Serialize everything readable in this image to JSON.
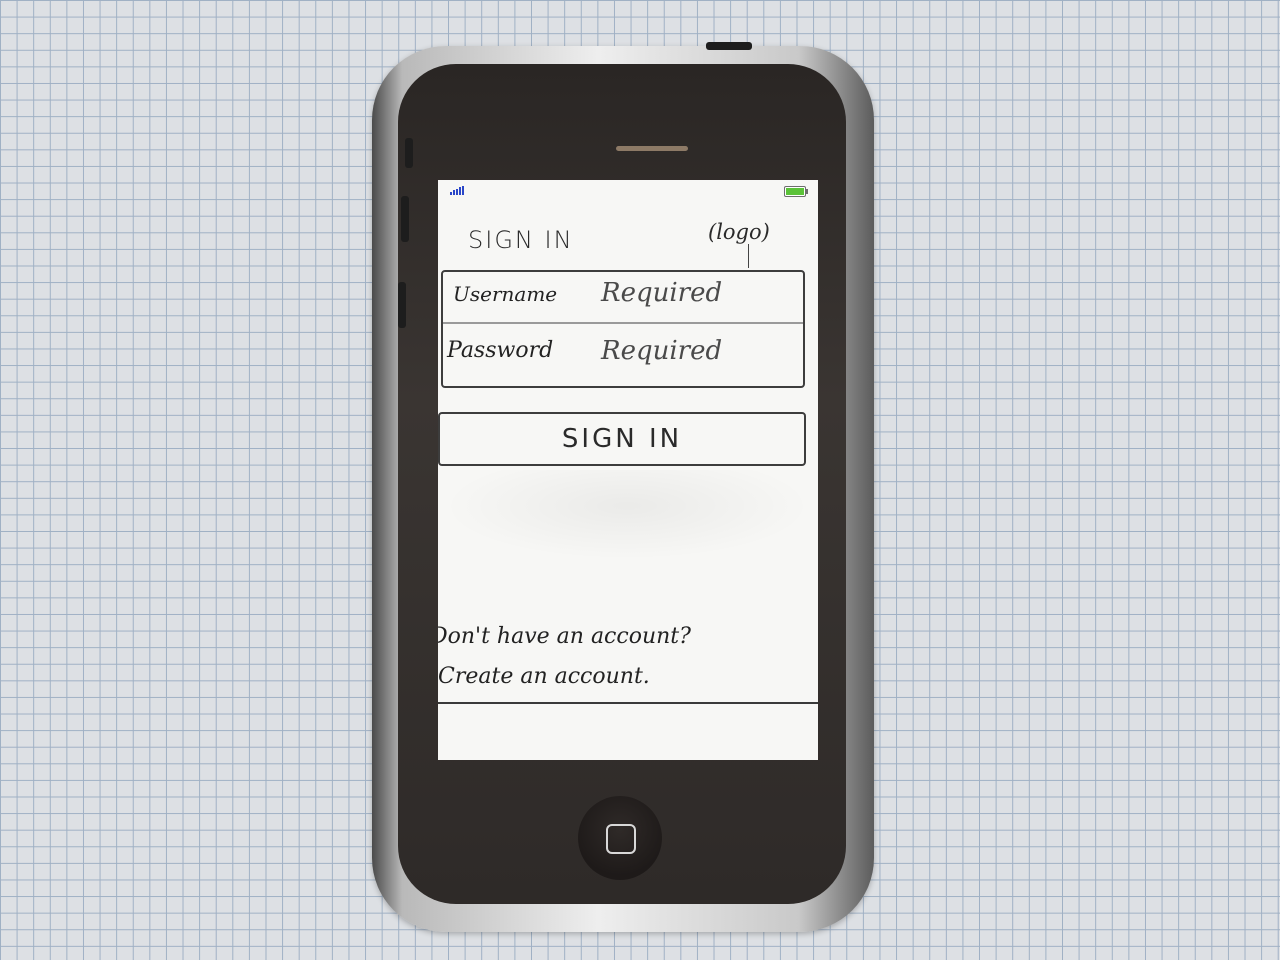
{
  "screen": {
    "title": "SIGN IN",
    "logo_label": "(logo)",
    "form": {
      "username_label": "Username",
      "username_value": "Required",
      "password_label": "Password",
      "password_value": "Required"
    },
    "signin_button": "SIGN IN",
    "footer": {
      "prompt": "Don't have an account?",
      "link": "Create an account."
    }
  },
  "colors": {
    "battery": "#5bc238",
    "signal": "#2a46c8"
  },
  "icons": [
    "signal-icon",
    "battery-icon",
    "home-button-icon"
  ]
}
